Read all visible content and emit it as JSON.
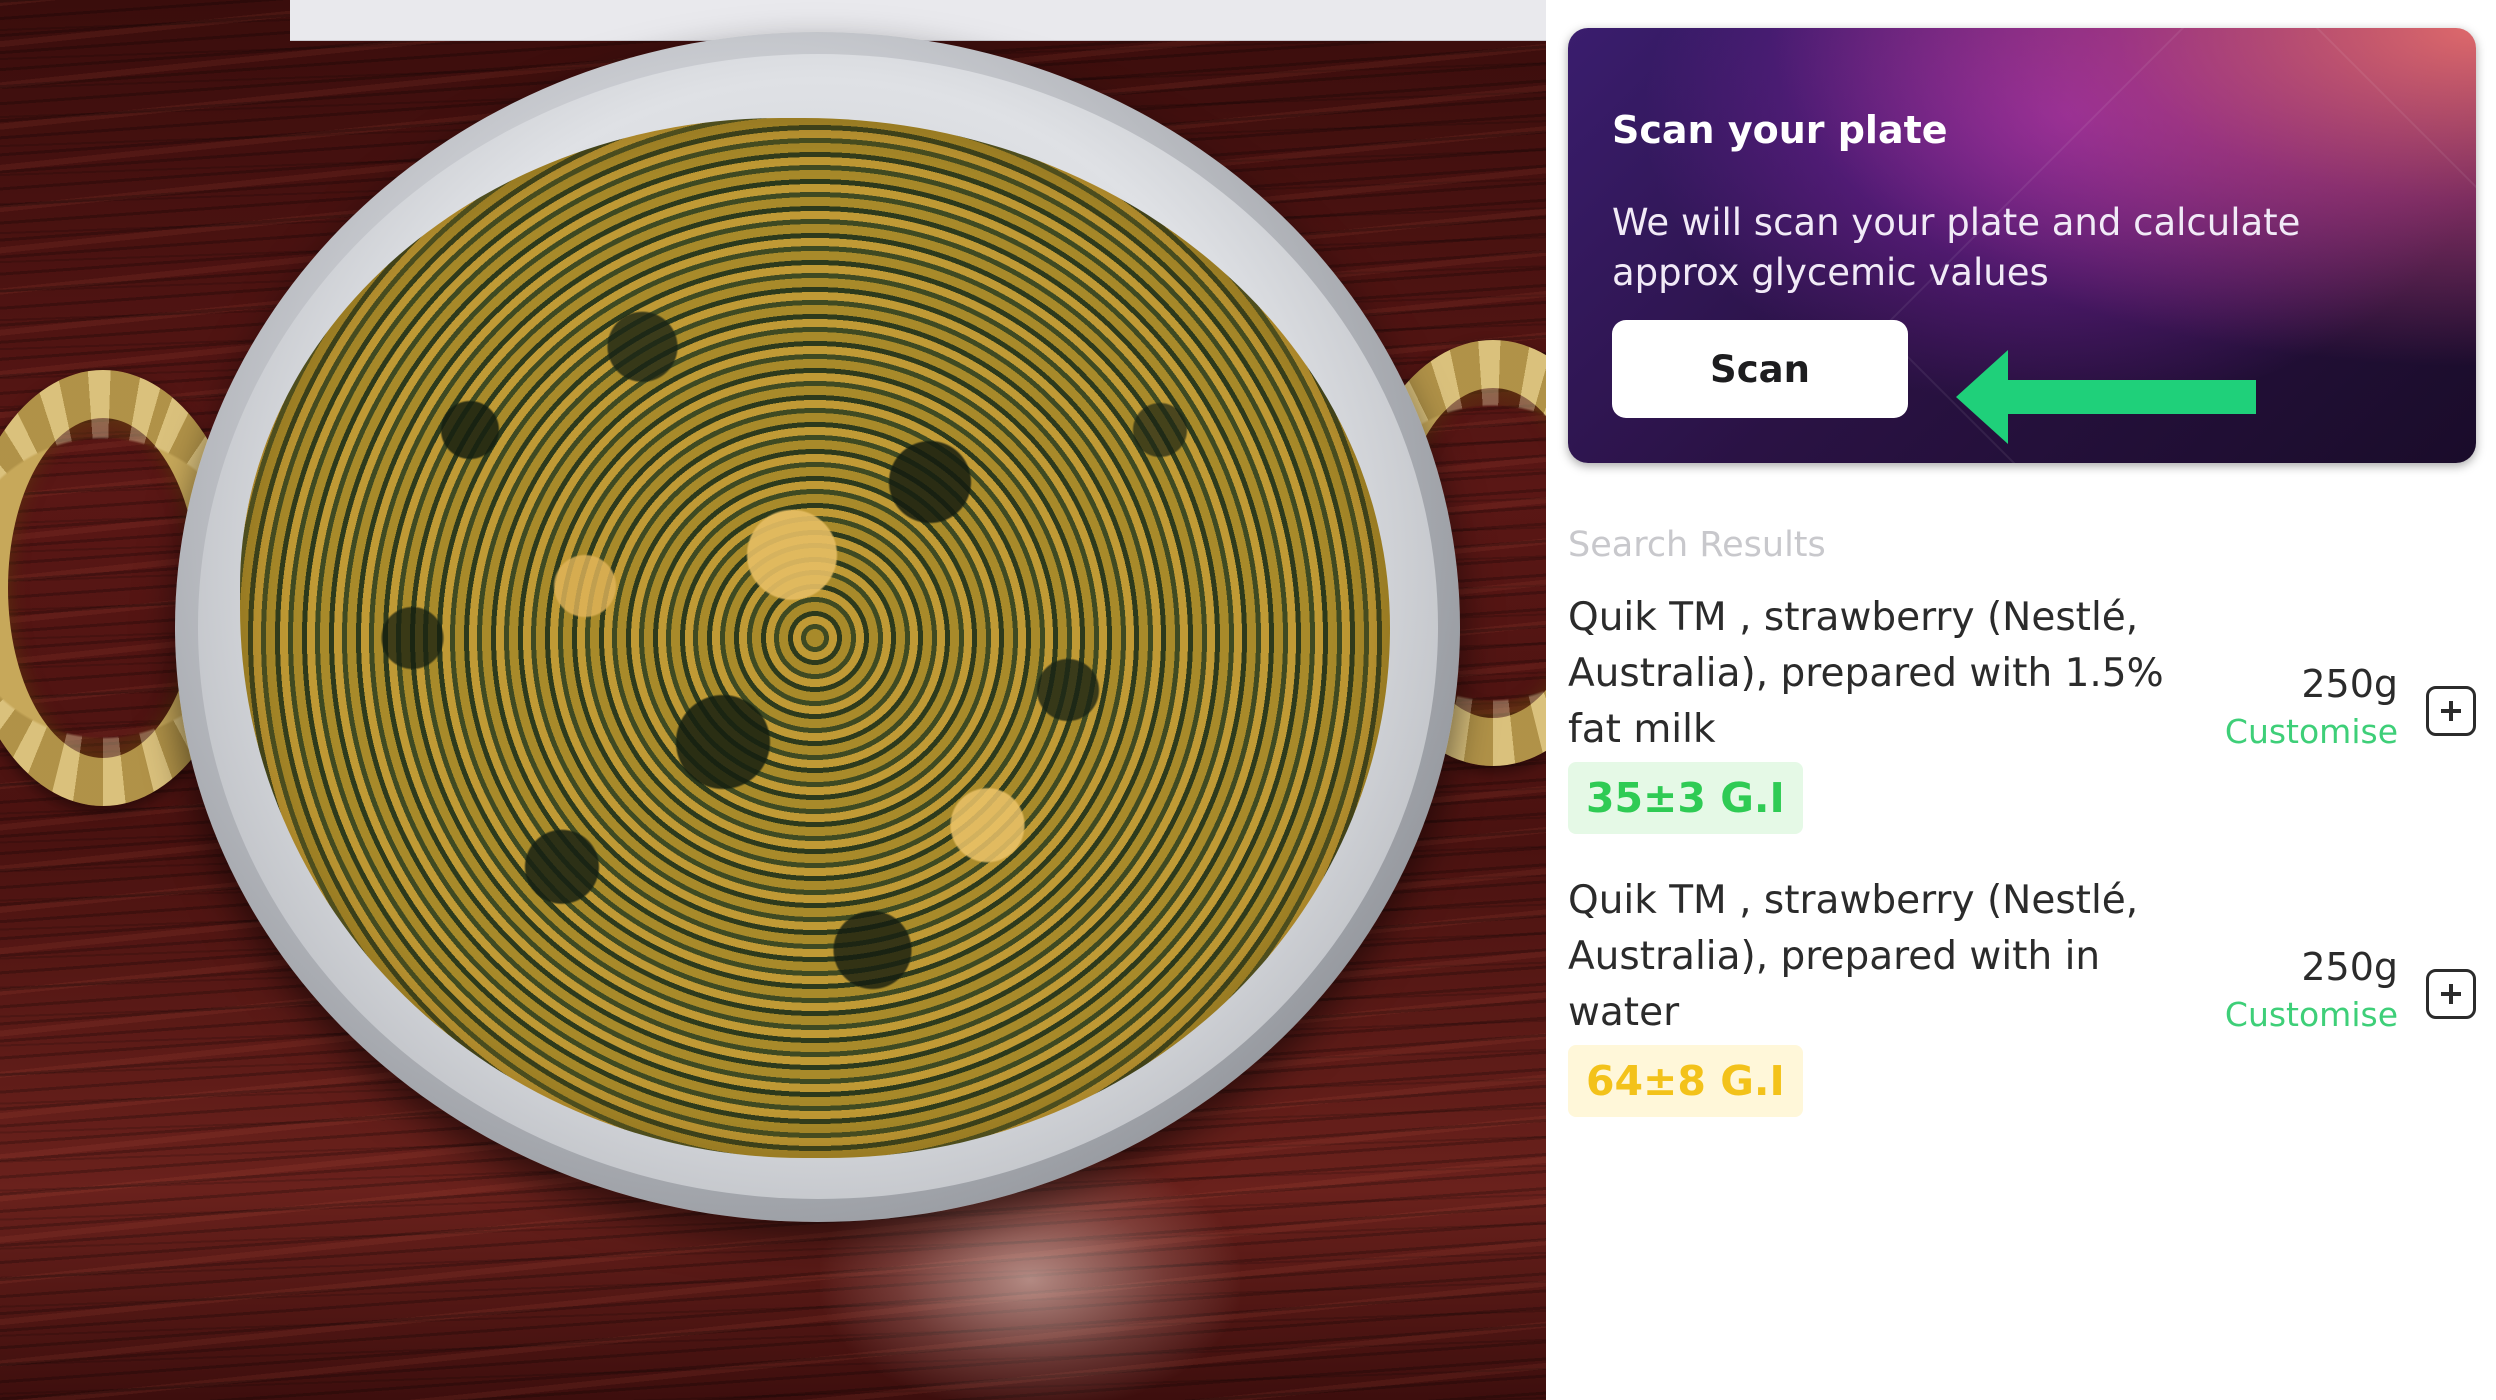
{
  "scan_card": {
    "title": "Scan your plate",
    "description": "We will scan your plate and calculate approx glycemic values",
    "button_label": "Scan",
    "arrow_color": "#1fd07a"
  },
  "search_results": {
    "heading": "Search Results",
    "items": [
      {
        "name": "Quik TM , strawberry (Nestlé, Australia), prepared with 1.5% fat milk",
        "gi": "35±3 G.I",
        "gi_color": "#2fcb54",
        "weight": "250g",
        "customise_label": "Customise"
      },
      {
        "name": "Quik TM , strawberry (Nestlé, Australia), prepared with in water",
        "gi": "64±8 G.I",
        "gi_color": "#f3c21a",
        "weight": "250g",
        "customise_label": "Customise"
      }
    ]
  },
  "photo": {
    "subject": "bowl-with-handles"
  },
  "colors": {
    "accent_green": "#3ecf78",
    "card_gradient_start": "#3a1d6e",
    "card_gradient_end": "#1a0c2a"
  }
}
